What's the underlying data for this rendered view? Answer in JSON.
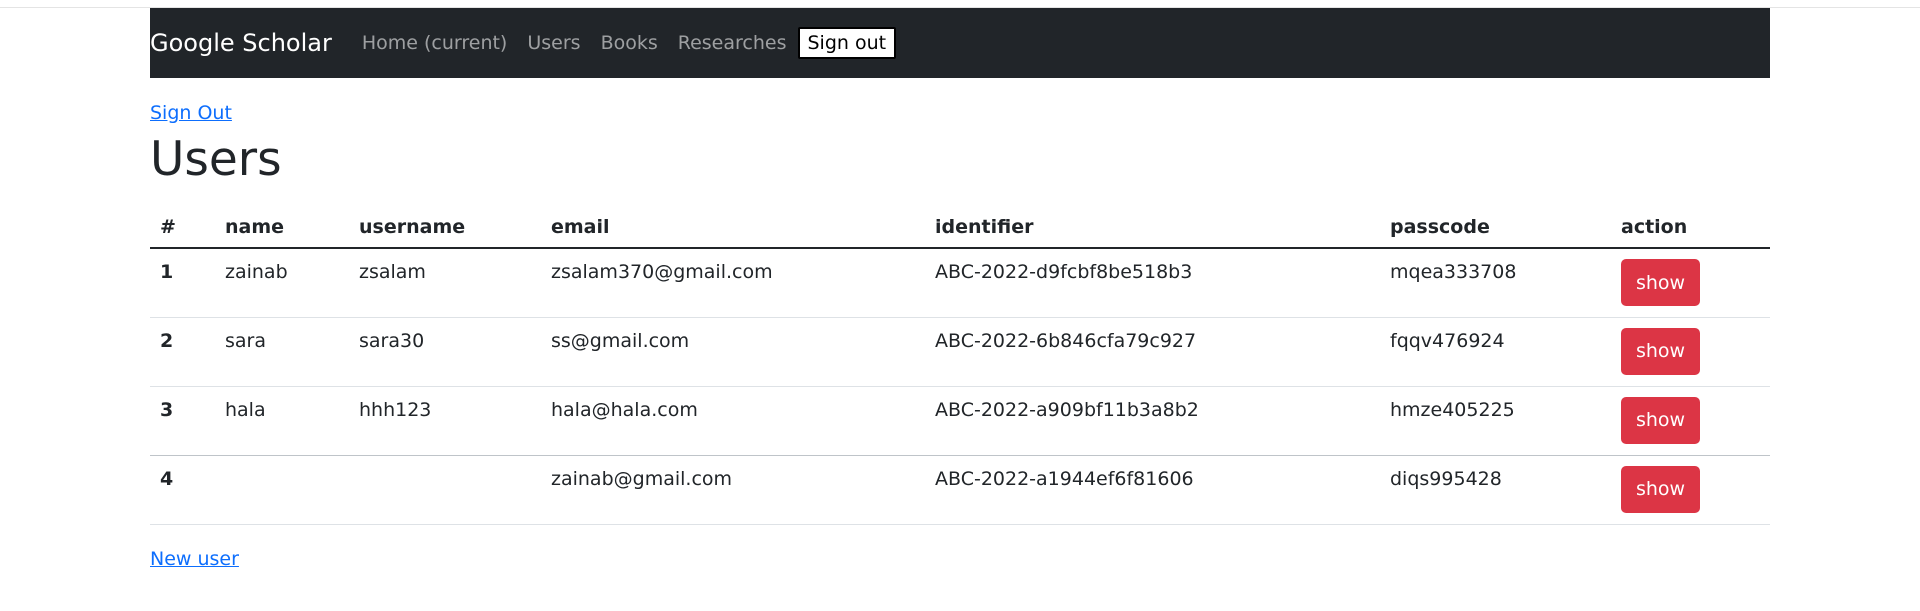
{
  "navbar": {
    "brand": "Google Scholar",
    "links": [
      "Home (current)",
      "Users",
      "Books",
      "Researches"
    ],
    "signout_button": "Sign out"
  },
  "signout_link": "Sign Out",
  "page_title": "Users",
  "table": {
    "headers": [
      "#",
      "name",
      "username",
      "email",
      "identifier",
      "passcode",
      "action"
    ],
    "rows": [
      {
        "index": "1",
        "name": "zainab",
        "username": "zsalam",
        "email": "zsalam370@gmail.com",
        "identifier": "ABC-2022-d9fcbf8be518b3",
        "passcode": "mqea333708",
        "action": "show"
      },
      {
        "index": "2",
        "name": "sara",
        "username": "sara30",
        "email": "ss@gmail.com",
        "identifier": "ABC-2022-6b846cfa79c927",
        "passcode": "fqqv476924",
        "action": "show"
      },
      {
        "index": "3",
        "name": "hala",
        "username": "hhh123",
        "email": "hala@hala.com",
        "identifier": "ABC-2022-a909bf11b3a8b2",
        "passcode": "hmze405225",
        "action": "show"
      },
      {
        "index": "4",
        "name": "",
        "username": "",
        "email": "zainab@gmail.com",
        "identifier": "ABC-2022-a1944ef6f81606",
        "passcode": "diqs995428",
        "action": "show"
      }
    ]
  },
  "new_user_link": "New user",
  "colors": {
    "navbar_bg": "#212529",
    "link": "#0d6efd",
    "danger_button": "#dc3545"
  }
}
